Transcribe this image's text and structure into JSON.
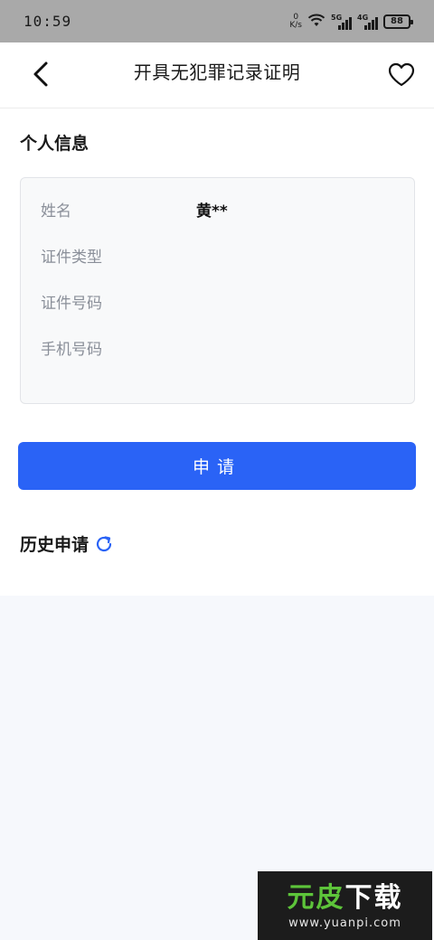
{
  "status_bar": {
    "time": "10:59",
    "net_speed_value": "0",
    "net_speed_unit": "K/s",
    "signal_5g_label": "5G",
    "signal_4g_label": "4G",
    "battery": "88"
  },
  "header": {
    "title": "开具无犯罪记录证明",
    "back_icon": "chevron-left-icon",
    "favorite_icon": "heart-outline-icon"
  },
  "personal_info": {
    "title": "个人信息",
    "rows": [
      {
        "label": "姓名",
        "value": "黄**"
      },
      {
        "label": "证件类型",
        "value": ""
      },
      {
        "label": "证件号码",
        "value": ""
      },
      {
        "label": "手机号码",
        "value": ""
      }
    ]
  },
  "apply_button_label": "申请",
  "history": {
    "title": "历史申请",
    "refresh_icon": "refresh-icon"
  },
  "watermark": {
    "brand_part1": "元皮",
    "brand_part2": "下载",
    "url": "www.yuanpi.com"
  },
  "colors": {
    "primary": "#2a63f6",
    "card_bg": "#f8f9fa",
    "label_gray": "#8a8f99",
    "status_bar_bg": "#a9a9a9",
    "page_bottom_bg": "#f6f8fc"
  }
}
